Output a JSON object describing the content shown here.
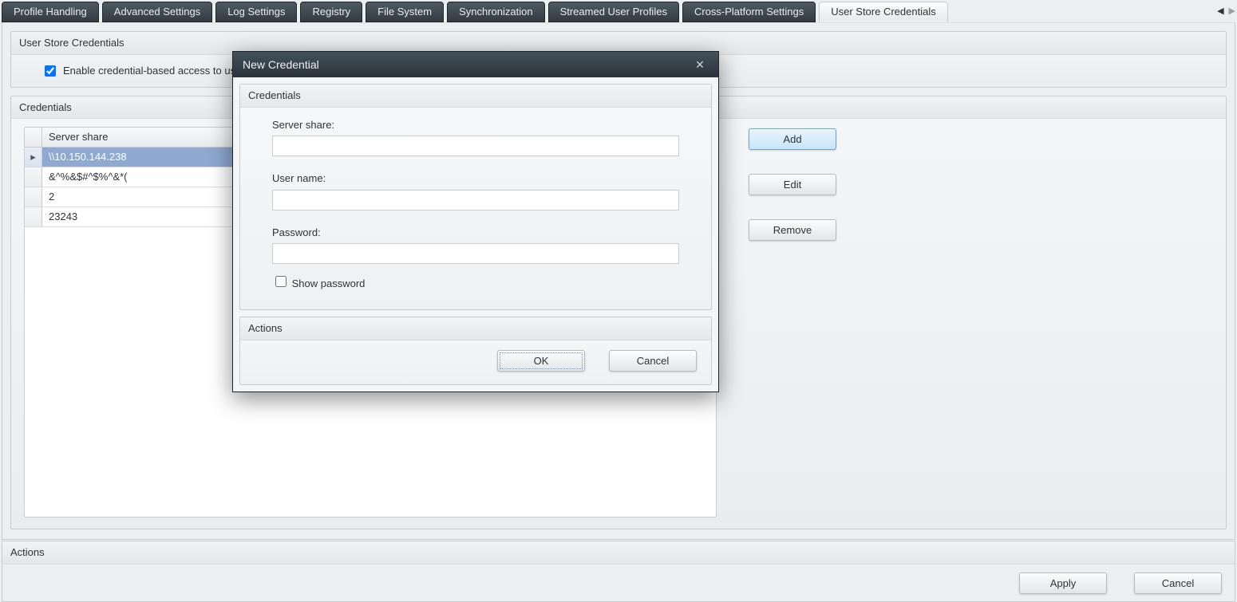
{
  "tabs": [
    {
      "label": "Profile Handling",
      "active": false
    },
    {
      "label": "Advanced Settings",
      "active": false
    },
    {
      "label": "Log Settings",
      "active": false
    },
    {
      "label": "Registry",
      "active": false
    },
    {
      "label": "File System",
      "active": false
    },
    {
      "label": "Synchronization",
      "active": false
    },
    {
      "label": "Streamed User Profiles",
      "active": false
    },
    {
      "label": "Cross-Platform Settings",
      "active": false
    },
    {
      "label": "User Store Credentials",
      "active": true
    }
  ],
  "page": {
    "usc_group_title": "User Store Credentials",
    "enable_checkbox_label": "Enable credential-based access to user store",
    "enable_checked": true,
    "credentials_group_title": "Credentials",
    "table": {
      "column_header": "Server share",
      "rows": [
        {
          "value": "\\\\10.150.144.238",
          "selected": true
        },
        {
          "value": "&^%&$#^$%^&*(",
          "selected": false
        },
        {
          "value": "2",
          "selected": false
        },
        {
          "value": "23243",
          "selected": false
        }
      ]
    },
    "buttons": {
      "add": "Add",
      "edit": "Edit",
      "remove": "Remove"
    }
  },
  "footer": {
    "actions_title": "Actions",
    "apply": "Apply",
    "cancel": "Cancel"
  },
  "dialog": {
    "title": "New Credential",
    "credentials_section_title": "Credentials",
    "server_share_label": "Server share:",
    "server_share_value": "",
    "user_name_label": "User name:",
    "user_name_value": "",
    "password_label": "Password:",
    "password_value": "",
    "show_password_label": "Show password",
    "show_password_checked": false,
    "actions_section_title": "Actions",
    "ok": "OK",
    "cancel": "Cancel"
  }
}
